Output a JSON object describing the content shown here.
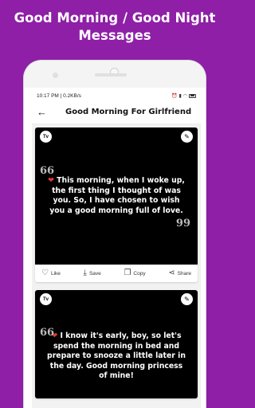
{
  "promo": {
    "line1": "Good Morning / Good Night",
    "line2": "Messages"
  },
  "status_bar": {
    "left": "10:17 PM | 0.2KB/s",
    "icons": [
      "alarm-icon",
      "signal-icon",
      "wifi-icon",
      "battery-icon"
    ]
  },
  "app_bar": {
    "back_icon": "back-arrow-icon",
    "title": "Good Morning For Girlfriend"
  },
  "cards": [
    {
      "badge": "Tv",
      "edit_icon": "pencil-icon",
      "heart": "❤",
      "text": " This morning, when I woke up, the first thing I thought of was you. So, I have chosen to wish you a good morning full of love.",
      "open_quote": "66",
      "close_quote": "99"
    },
    {
      "badge": "Tv",
      "edit_icon": "pencil-icon",
      "heart": "❤",
      "text": " I know it's early, boy, so let's spend the morning in bed and prepare to snooze a little later in the day. Good morning princess of mine!",
      "open_quote": "66"
    }
  ],
  "actions": {
    "like": "Like",
    "save": "Save",
    "copy": "Copy",
    "share": "Share"
  },
  "colors": {
    "background": "#8e1fa6",
    "card_background": "#000000",
    "heart": "#e53935"
  }
}
